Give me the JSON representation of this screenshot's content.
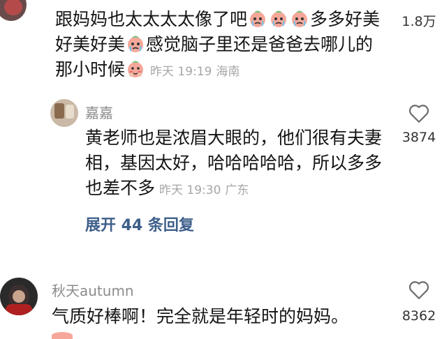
{
  "comments": [
    {
      "text_part1": "跟妈妈也太太太太像了吧",
      "text_part2": "多多好美好美好美",
      "text_part3": "感觉脑子里还是爸爸去哪儿的那小时候",
      "time": "昨天 19:19",
      "location": "海南",
      "likes": "1.8万",
      "emojis": [
        "crying-face-icon",
        "crying-face-icon",
        "crying-face-icon",
        "crying-face-icon",
        "shy-face-icon"
      ]
    }
  ],
  "reply": {
    "username": "嘉嘉",
    "text": "黄老师也是浓眉大眼的，他们很有夫妻相，基因太好，哈哈哈哈哈，所以多多也差不多",
    "time": "昨天 19:30",
    "location": "广东",
    "likes": "3874"
  },
  "expand_replies_label": "展开 44 条回复",
  "comment2": {
    "username": "秋天autumn",
    "text": "气质好棒啊！完全就是年轻时的妈妈。",
    "likes": "8362"
  },
  "colors": {
    "link": "#3e5f8a",
    "meta": "#a6a6a6",
    "username": "#8c8c8c",
    "emoji_face": "#f5a89a"
  }
}
